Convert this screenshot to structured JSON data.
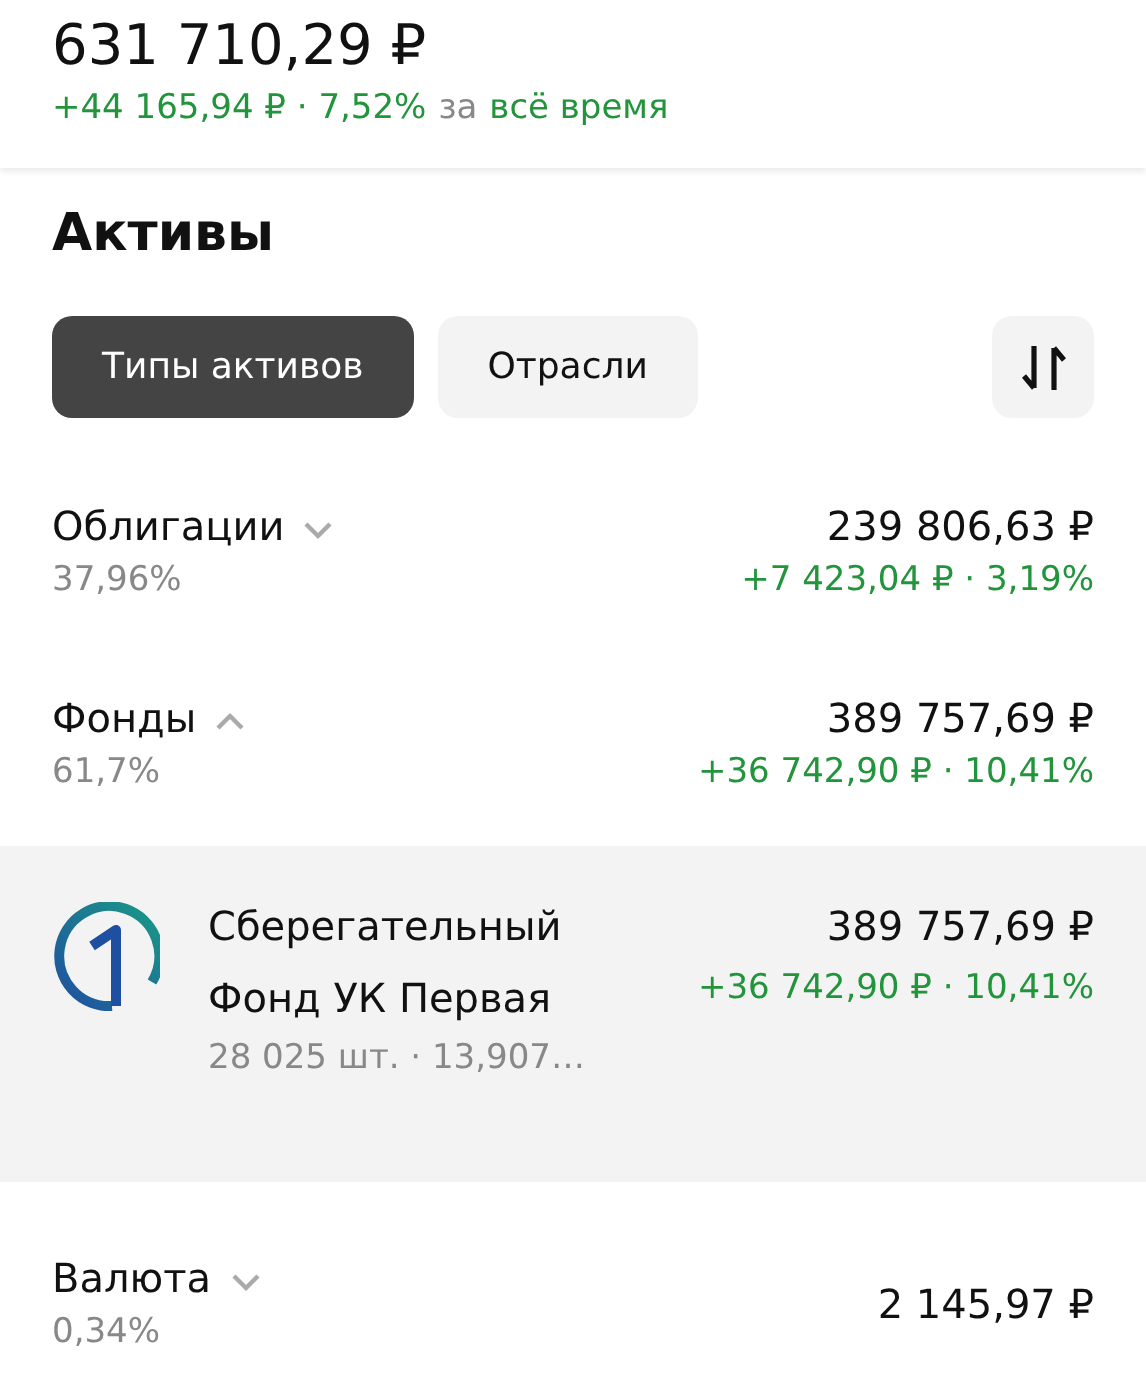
{
  "summary": {
    "total": "631 710,29 ₽",
    "change": "+44 165,94 ₽ · 7,52%",
    "period_prefix": "за",
    "period": "всё время"
  },
  "section": {
    "title": "Активы"
  },
  "tabs": [
    {
      "label": "Типы активов",
      "selected": true
    },
    {
      "label": "Отрасли",
      "selected": false
    }
  ],
  "groups": [
    {
      "name": "Облигации",
      "share": "37,96%",
      "expanded": false,
      "value": "239 806,63 ₽",
      "change": "+7 423,04 ₽ · 3,19%"
    },
    {
      "name": "Фонды",
      "share": "61,7%",
      "expanded": true,
      "value": "389 757,69 ₽",
      "change": "+36 742,90 ₽ · 10,41%",
      "holdings": [
        {
          "name": "Сберегательный Фонд УК Первая",
          "meta": "28 025 шт. · 13,907…",
          "value": "389 757,69 ₽",
          "change": "+36 742,90 ₽ · 10,41%"
        }
      ]
    },
    {
      "name": "Валюта",
      "share": "0,34%",
      "expanded": false,
      "value": "2 145,97 ₽"
    }
  ]
}
